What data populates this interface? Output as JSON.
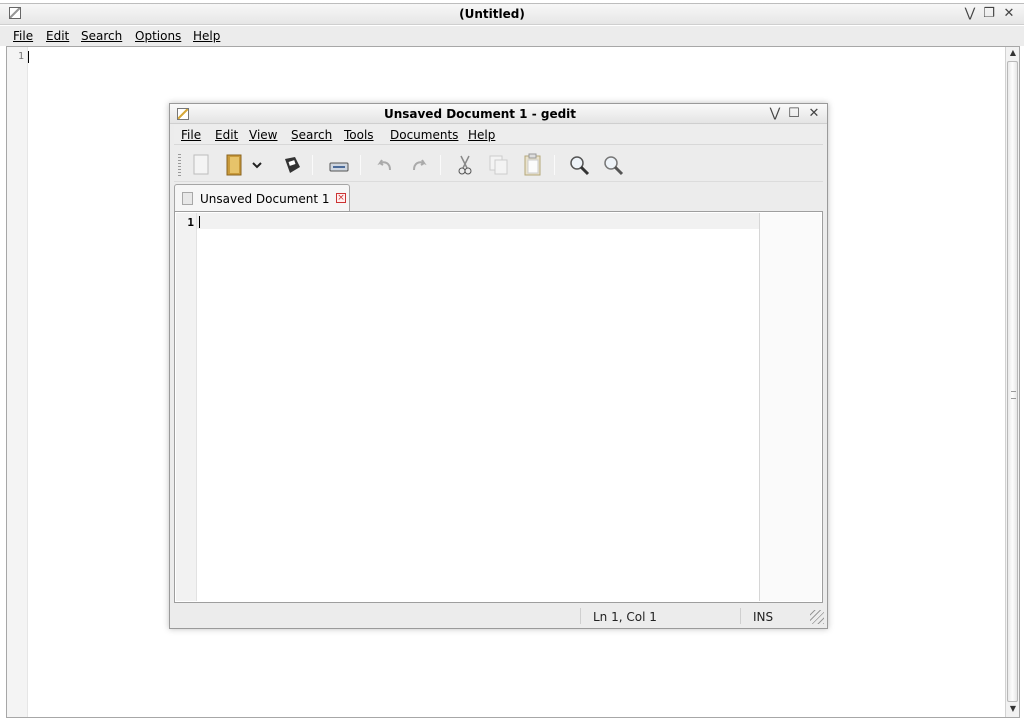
{
  "outer_window": {
    "title": "(Untitled)",
    "menu": [
      "File",
      "Edit",
      "Search",
      "Options",
      "Help"
    ],
    "line_number": "1"
  },
  "gedit": {
    "title": "Unsaved Document 1 - gedit",
    "menu": [
      "File",
      "Edit",
      "View",
      "Search",
      "Tools",
      "Documents",
      "Help"
    ],
    "toolbar": [
      "new-document",
      "open",
      "open-dropdown",
      "save",
      "print",
      "undo",
      "redo",
      "cut",
      "copy",
      "paste",
      "find",
      "find-and-replace"
    ],
    "tab_label": "Unsaved Document 1",
    "line_number": "1",
    "status": {
      "position": "Ln 1, Col 1",
      "mode": "INS"
    }
  }
}
